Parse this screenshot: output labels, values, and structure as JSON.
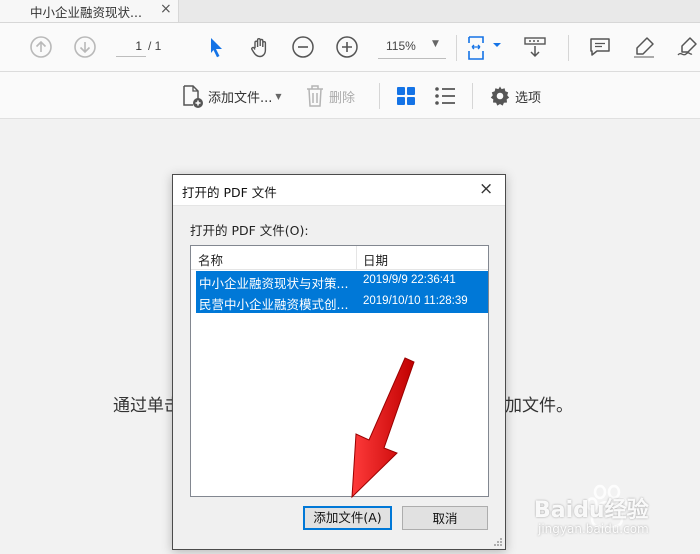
{
  "tab": {
    "title": "中小企业融资现状...",
    "close": "×"
  },
  "toolbar": {
    "page_current": "1",
    "page_total": "/ 1",
    "zoom": "115%"
  },
  "toolbar2": {
    "add_files": "添加文件...",
    "delete": "删除",
    "options": "选项"
  },
  "background_message": {
    "left": "通过单击",
    "right": "加文件。"
  },
  "dialog": {
    "title": "打开的 PDF 文件",
    "close": "×",
    "label": "打开的 PDF 文件(O):",
    "columns": {
      "name": "名称",
      "date": "日期"
    },
    "rows": [
      {
        "name": "中小企业融资现状与对策...",
        "date": "2019/9/9 22:36:41"
      },
      {
        "name": "民营中小企业融资模式创...",
        "date": "2019/10/10 11:28:39"
      }
    ],
    "add_button": "添加文件(A)",
    "cancel_button": "取消"
  },
  "watermark": {
    "brand": "Baidu经验",
    "url": "jingyan.baidu.com"
  },
  "colors": {
    "accent": "#1473e6",
    "selection": "#0078d7",
    "arrow": "#e01010"
  }
}
